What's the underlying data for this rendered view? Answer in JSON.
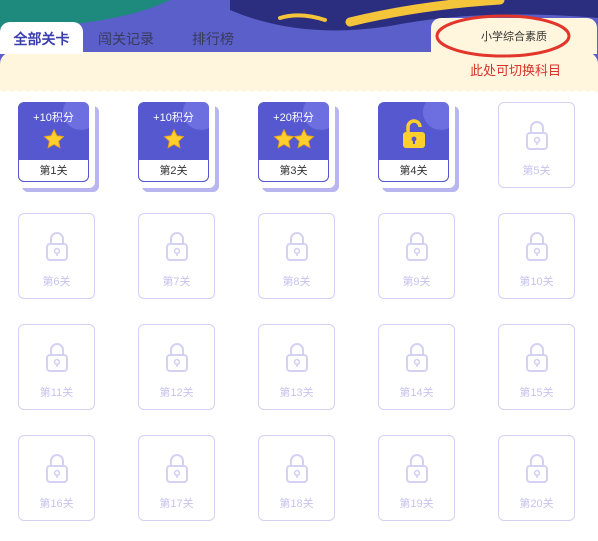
{
  "tabs": [
    {
      "label": "全部关卡",
      "active": true
    },
    {
      "label": "闯关记录",
      "active": false
    },
    {
      "label": "排行榜",
      "active": false
    }
  ],
  "subject": {
    "label": "小学综合素质"
  },
  "annotation": {
    "hint": "此处可切换科目",
    "color": "#d8332a"
  },
  "colors": {
    "header": "#5a5fc9",
    "accent": "#3b3fae",
    "card": "#5658cf",
    "locked_border": "#d4d1f2",
    "star": "#ffcf2e"
  },
  "levels": [
    {
      "label": "第1关",
      "points": "+10积分",
      "stars": 1,
      "state": "completed"
    },
    {
      "label": "第2关",
      "points": "+10积分",
      "stars": 1,
      "state": "completed"
    },
    {
      "label": "第3关",
      "points": "+20积分",
      "stars": 2,
      "state": "completed"
    },
    {
      "label": "第4关",
      "points": "",
      "stars": 0,
      "state": "unlocked",
      "icon": "unlock-icon"
    },
    {
      "label": "第5关",
      "state": "locked",
      "icon": "lock-icon"
    },
    {
      "label": "第6关",
      "state": "locked",
      "icon": "lock-icon"
    },
    {
      "label": "第7关",
      "state": "locked",
      "icon": "lock-icon"
    },
    {
      "label": "第8关",
      "state": "locked",
      "icon": "lock-icon"
    },
    {
      "label": "第9关",
      "state": "locked",
      "icon": "lock-icon"
    },
    {
      "label": "第10关",
      "state": "locked",
      "icon": "lock-icon"
    },
    {
      "label": "第11关",
      "state": "locked",
      "icon": "lock-icon"
    },
    {
      "label": "第12关",
      "state": "locked",
      "icon": "lock-icon"
    },
    {
      "label": "第13关",
      "state": "locked",
      "icon": "lock-icon"
    },
    {
      "label": "第14关",
      "state": "locked",
      "icon": "lock-icon"
    },
    {
      "label": "第15关",
      "state": "locked",
      "icon": "lock-icon"
    },
    {
      "label": "第16关",
      "state": "locked",
      "icon": "lock-icon"
    },
    {
      "label": "第17关",
      "state": "locked",
      "icon": "lock-icon"
    },
    {
      "label": "第18关",
      "state": "locked",
      "icon": "lock-icon"
    },
    {
      "label": "第19关",
      "state": "locked",
      "icon": "lock-icon"
    },
    {
      "label": "第20关",
      "state": "locked",
      "icon": "lock-icon"
    }
  ]
}
